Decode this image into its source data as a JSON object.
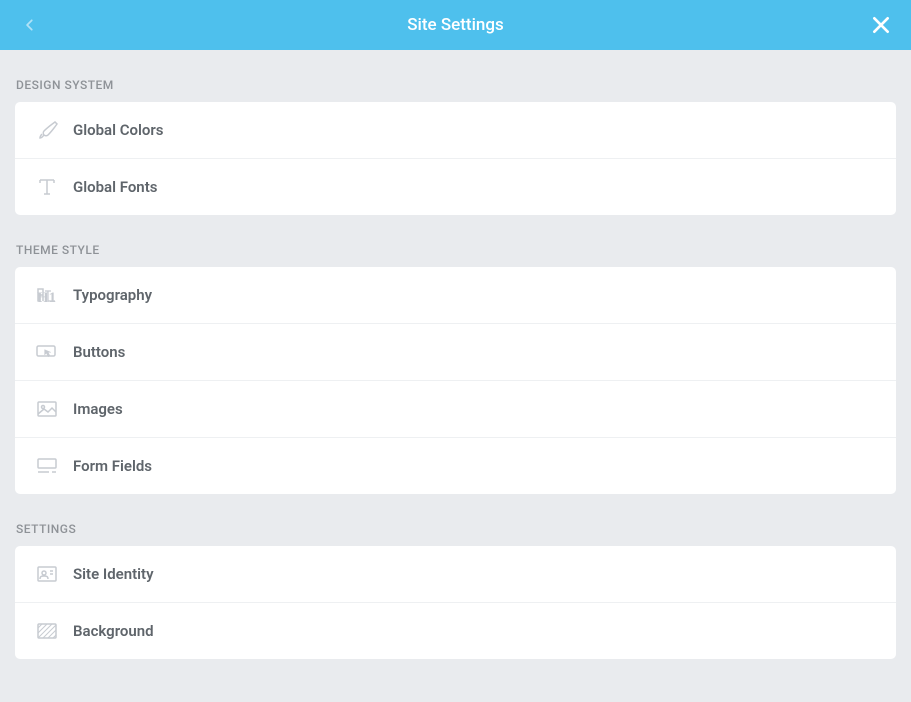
{
  "header": {
    "title": "Site Settings"
  },
  "sections": {
    "design_system": {
      "title": "DESIGN SYSTEM",
      "items": [
        {
          "label": "Global Colors"
        },
        {
          "label": "Global Fonts"
        }
      ]
    },
    "theme_style": {
      "title": "THEME STYLE",
      "items": [
        {
          "label": "Typography"
        },
        {
          "label": "Buttons"
        },
        {
          "label": "Images"
        },
        {
          "label": "Form Fields"
        }
      ]
    },
    "settings": {
      "title": "SETTINGS",
      "items": [
        {
          "label": "Site Identity"
        },
        {
          "label": "Background"
        }
      ]
    }
  }
}
